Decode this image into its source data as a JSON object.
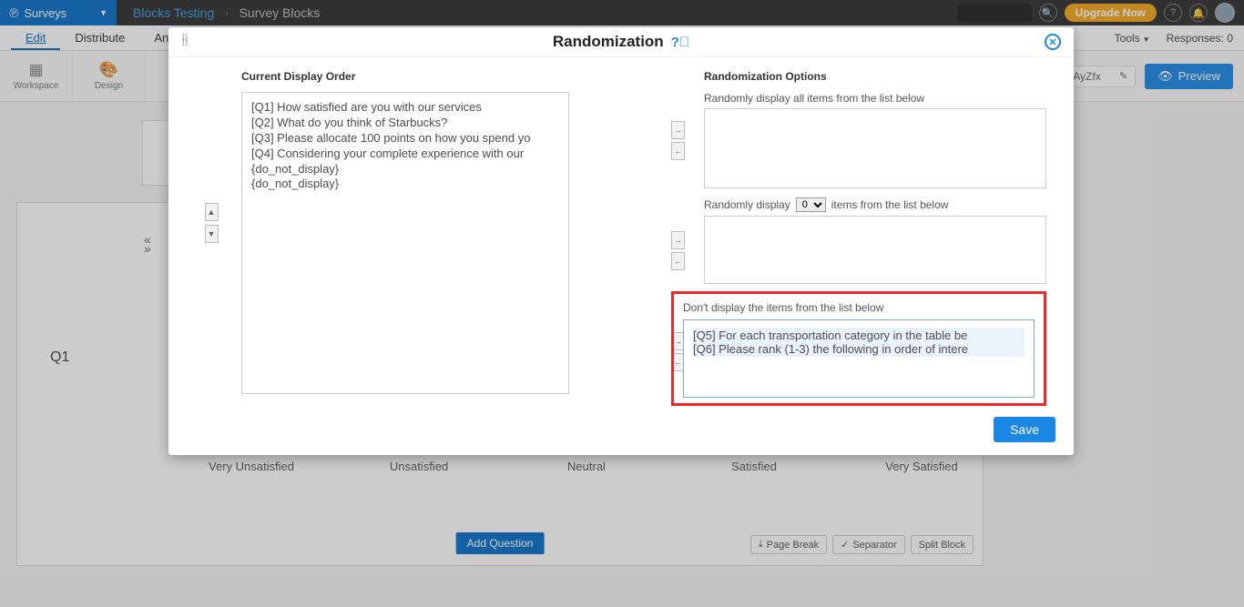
{
  "topbar": {
    "brand": "Surveys",
    "crumb_a": "Blocks Testing",
    "crumb_b": "Survey Blocks",
    "upgrade": "Upgrade Now"
  },
  "tabs": {
    "edit": "Edit",
    "distribute": "Distribute",
    "analytics": "Analyt",
    "tools": "Tools",
    "responses_label": "Responses:",
    "responses_count": "0"
  },
  "toolbar": {
    "workspace": "Workspace",
    "design": "Design",
    "url_frag": "t/AOXAyZfx",
    "preview": "Preview"
  },
  "survey": {
    "q_label": "Q1",
    "likert": [
      "Very Unsatisfied",
      "Unsatisfied",
      "Neutral",
      "Satisfied",
      "Very Satisfied"
    ],
    "add_question": "Add Question",
    "page_break": "Page Break",
    "separator": "Separator",
    "split_block": "Split Block"
  },
  "modal": {
    "title": "Randomization",
    "left_header": "Current Display Order",
    "right_header": "Randomization Options",
    "rand_all_label": "Randomly display all items from the list below",
    "rand_some_prefix": "Randomly display",
    "rand_some_count": "0",
    "rand_some_suffix": "items from the list below",
    "dont_display_label": "Don't display the items from the list below",
    "save": "Save",
    "items": [
      "[Q1] How satisfied are you with our services",
      "[Q2] What do you think of Starbucks?",
      "[Q3] Please allocate 100 points on how you spend yo",
      "[Q4] Considering your complete experience with our",
      "{do_not_display}",
      "{do_not_display}"
    ],
    "dont_items": [
      "[Q5] For each transportation category in the table be",
      "[Q6] Please rank (1-3) the following in order of intere"
    ]
  }
}
